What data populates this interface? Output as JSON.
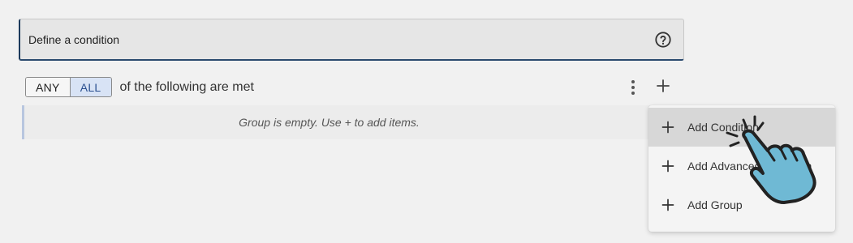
{
  "header": {
    "title": "Define a condition",
    "help_icon": "question-circle-icon"
  },
  "match_toggle": {
    "options": [
      "ANY",
      "ALL"
    ],
    "selected": "ALL"
  },
  "rule_text": "of the following are met",
  "group": {
    "empty_message": "Group is empty. Use + to add items."
  },
  "menu": {
    "items": [
      {
        "label": "Add Condition",
        "icon": "plus-icon"
      },
      {
        "label": "Add Advanced Condition",
        "icon": "plus-icon"
      },
      {
        "label": "Add Group",
        "icon": "plus-icon"
      }
    ]
  },
  "colors": {
    "accent_border": "#1d3a5c",
    "selected_toggle_bg": "#d8e3f5",
    "selected_toggle_text": "#2a4f8f",
    "hand_fill": "#6fb9d4",
    "menu_hover_bg": "#d7d7d7"
  }
}
